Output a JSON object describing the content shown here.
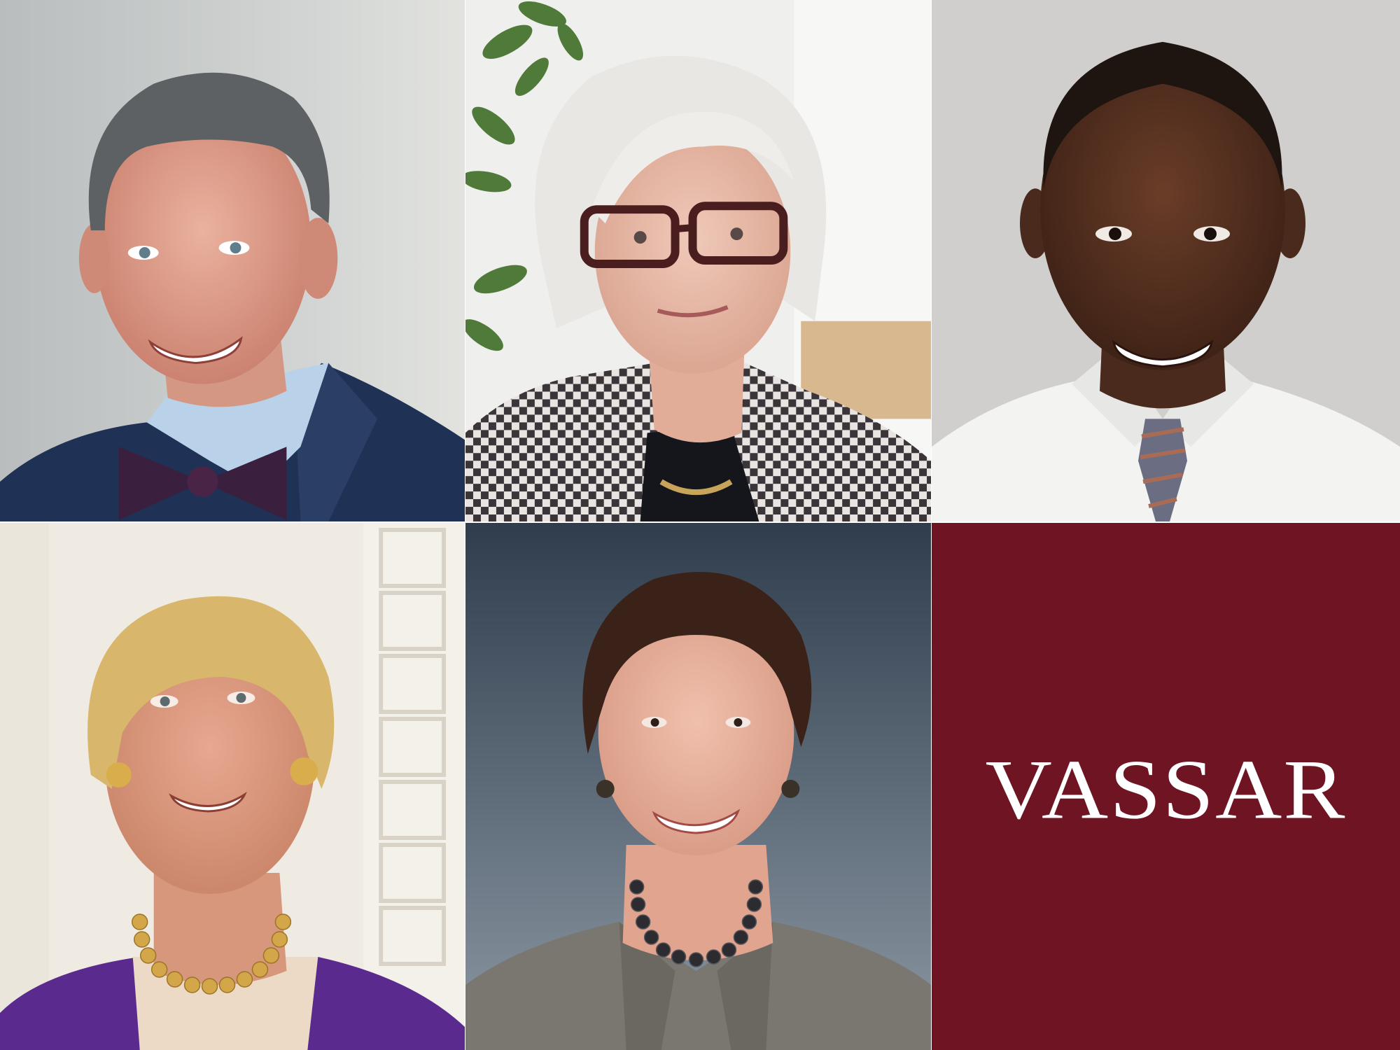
{
  "brand": {
    "wordmark": "VASSAR",
    "background_color": "#6e1423",
    "text_color": "#ffffff"
  },
  "portraits": [
    {
      "id": "portrait-1",
      "subject": "man-gray-hair-navy-suit-bow-tie"
    },
    {
      "id": "portrait-2",
      "subject": "woman-white-hair-red-glasses-houndstooth-jacket"
    },
    {
      "id": "portrait-3",
      "subject": "man-white-shirt-striped-tie"
    },
    {
      "id": "portrait-4",
      "subject": "woman-blonde-hair-purple-cardigan-pearls"
    },
    {
      "id": "portrait-5",
      "subject": "woman-dark-hair-gray-jacket-black-pearls"
    }
  ]
}
